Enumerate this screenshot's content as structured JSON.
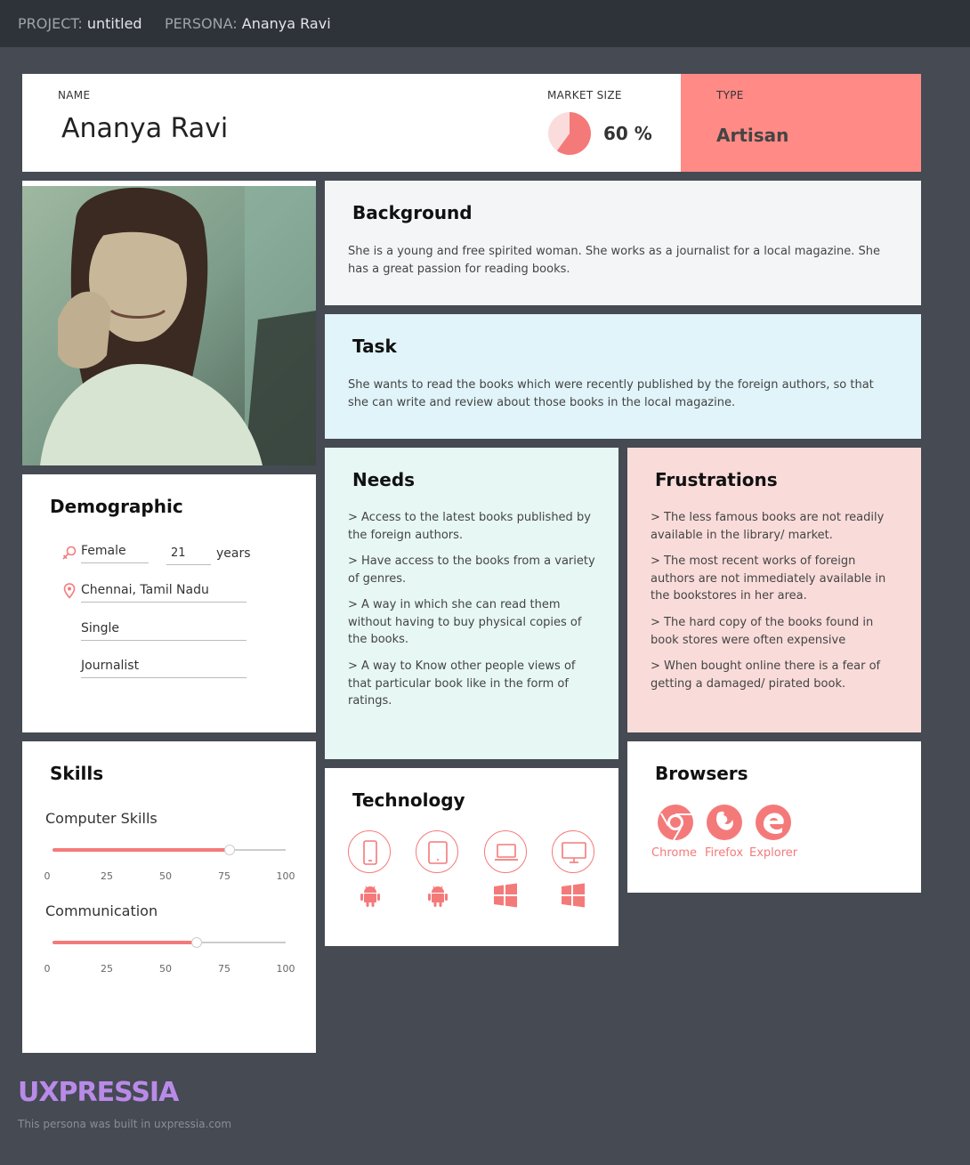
{
  "topbar": {
    "project_label": "PROJECT:",
    "project_value": "untitled",
    "persona_label": "PERSONA:",
    "persona_value": "Ananya Ravi"
  },
  "header": {
    "name_label": "NAME",
    "name": "Ananya Ravi",
    "market_label": "MARKET SIZE",
    "market_value": "60 %",
    "market_fraction": 0.6,
    "type_label": "TYPE",
    "type_value": "Artisan"
  },
  "background": {
    "title": "Background",
    "text": "She is a young and free spirited woman. She works as a journalist for a local magazine. She has a great passion for reading books."
  },
  "task": {
    "title": "Task",
    "text": "She wants to read the books which were recently published by the foreign authors, so that she can write and review about those books in the local magazine."
  },
  "demographic": {
    "title": "Demographic",
    "gender": "Female",
    "age": "21",
    "age_unit": "years",
    "location": "Chennai, Tamil Nadu",
    "status": "Single",
    "occupation": "Journalist"
  },
  "needs": {
    "title": "Needs",
    "items": [
      "> Access to the latest books published by the foreign authors.",
      "> Have access to the books from a variety of genres.",
      "> A way in which she can read them without having to buy physical copies of the books.",
      "> A way to Know other people views of that particular book like in the form of ratings."
    ]
  },
  "frustrations": {
    "title": "Frustrations",
    "items": [
      "> The less famous books are not readily available in the library/ market.",
      "> The most recent works of foreign authors are not immediately available in the bookstores in her area.",
      ">  The hard copy of the books found in book stores were often expensive",
      "> When bought online there is a fear of getting a damaged/ pirated book."
    ]
  },
  "skills": {
    "title": "Skills",
    "items": [
      {
        "label": "Computer Skills",
        "value": 0.76
      },
      {
        "label": "Communication",
        "value": 0.62
      }
    ],
    "ticks": [
      "0",
      "25",
      "50",
      "75",
      "100"
    ]
  },
  "technology": {
    "title": "Technology",
    "devices": [
      "mobile-icon",
      "tablet-icon",
      "laptop-icon",
      "desktop-icon"
    ],
    "os": [
      "android-icon",
      "android-icon",
      "windows-icon",
      "windows-icon"
    ]
  },
  "browsers": {
    "title": "Browsers",
    "items": [
      "Chrome",
      "Firefox",
      "Explorer"
    ]
  },
  "footer": {
    "logo": "UXPRESSIA",
    "note": "This persona was built in uxpressia.com"
  },
  "colors": {
    "accent": "#f47a7a",
    "type_bg": "#ff8a86",
    "task_bg": "#e0f4f9",
    "needs_bg": "#e6f7f4",
    "frustrations_bg": "#f9dcda",
    "background_bg": "#f4f5f7"
  }
}
